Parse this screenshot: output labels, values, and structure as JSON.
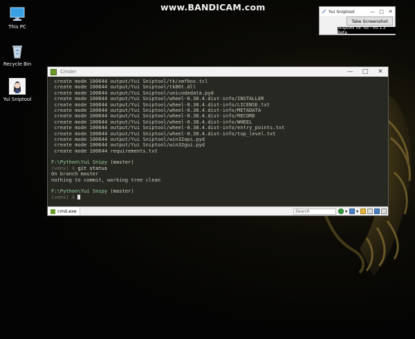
{
  "watermark": "www.BANDICAM.com",
  "desktop_icons": [
    {
      "label": "This PC",
      "icon": "monitor-icon"
    },
    {
      "label": "Recycle Bin",
      "icon": "recycle-bin-icon"
    },
    {
      "label": "Yui Sniptool",
      "icon": "yui-avatar-icon"
    }
  ],
  "sniptool": {
    "title": "Yui Sniptool",
    "button_label": "Take Screenshot",
    "version_label": "Sniptool for Yui - v0.1.2 Beta",
    "controls": [
      "—",
      "□",
      "✕"
    ]
  },
  "cmder": {
    "title": "Cmder",
    "controls": [
      "—",
      "□",
      "✕"
    ],
    "lines": [
      {
        "kind": "out",
        "text": " create mode 100644 output/Yui Sniptool/tk/xmfbox.tcl"
      },
      {
        "kind": "out",
        "text": " create mode 100644 output/Yui Sniptool/tk86t.dll"
      },
      {
        "kind": "out",
        "text": " create mode 100644 output/Yui Sniptool/unicodedata.pyd"
      },
      {
        "kind": "out",
        "text": " create mode 100644 output/Yui Sniptool/wheel-0.38.4.dist-info/INSTALLER"
      },
      {
        "kind": "out",
        "text": " create mode 100644 output/Yui Sniptool/wheel-0.38.4.dist-info/LICENSE.txt"
      },
      {
        "kind": "out",
        "text": " create mode 100644 output/Yui Sniptool/wheel-0.38.4.dist-info/METADATA"
      },
      {
        "kind": "out",
        "text": " create mode 100644 output/Yui Sniptool/wheel-0.38.4.dist-info/RECORD"
      },
      {
        "kind": "out",
        "text": " create mode 100644 output/Yui Sniptool/wheel-0.38.4.dist-info/WHEEL"
      },
      {
        "kind": "out",
        "text": " create mode 100644 output/Yui Sniptool/wheel-0.38.4.dist-info/entry_points.txt"
      },
      {
        "kind": "out",
        "text": " create mode 100644 output/Yui Sniptool/wheel-0.38.4.dist-info/top_level.txt"
      },
      {
        "kind": "out",
        "text": " create mode 100644 output/Yui Sniptool/win32api.pyd"
      },
      {
        "kind": "out",
        "text": " create mode 100644 output/Yui Sniptool/win32gui.pyd"
      },
      {
        "kind": "out",
        "text": " create mode 100644 requirements.txt"
      },
      {
        "kind": "blank",
        "text": ""
      },
      {
        "kind": "prompt",
        "path": "F:\\Python\\Yui Snipy",
        "branch": " (master)"
      },
      {
        "kind": "cmd",
        "venv": "(venv) λ ",
        "cmd": "git status"
      },
      {
        "kind": "out",
        "text": "On branch master"
      },
      {
        "kind": "out",
        "text": "nothing to commit, working tree clean"
      },
      {
        "kind": "blank",
        "text": ""
      },
      {
        "kind": "prompt",
        "path": "F:\\Python\\Yui Snipy",
        "branch": " (master)"
      },
      {
        "kind": "cursor",
        "venv": "(venv) λ "
      }
    ],
    "status": {
      "tab_label": "cmd.exe",
      "search_placeholder": "Search"
    }
  }
}
